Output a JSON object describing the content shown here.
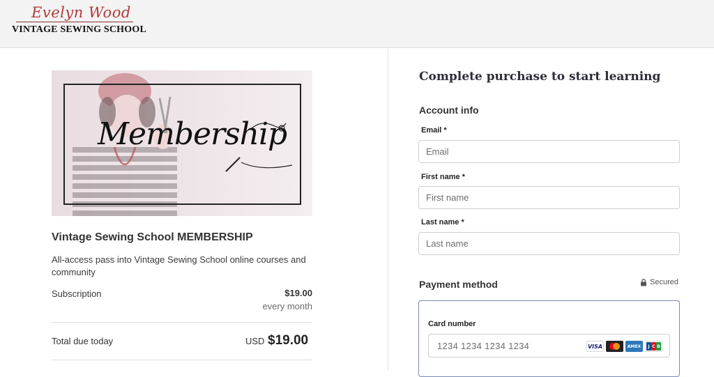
{
  "header": {
    "logo_script": "Evelyn Wood",
    "logo_sub": "VINTAGE SEWING SCHOOL"
  },
  "product": {
    "hero_title": "Membership",
    "title": "Vintage Sewing School MEMBERSHIP",
    "description": "All-access pass into Vintage Sewing School online courses and community",
    "subscription_label": "Subscription",
    "subscription_price": "$19.00",
    "subscription_period": "every month",
    "total_label": "Total due today",
    "total_currency": "USD",
    "total_amount": "$19.00"
  },
  "checkout": {
    "heading": "Complete purchase to start learning",
    "account_section": "Account info",
    "fields": {
      "email_label": "Email *",
      "email_placeholder": "Email",
      "first_name_label": "First name *",
      "first_name_placeholder": "First name",
      "last_name_label": "Last name *",
      "last_name_placeholder": "Last name"
    },
    "payment": {
      "title": "Payment method",
      "secured": "Secured",
      "card_number_label": "Card number",
      "card_number_placeholder": "1234 1234 1234 1234",
      "card_brands": [
        "VISA",
        "Mastercard",
        "AMEX",
        "JCB"
      ]
    }
  },
  "colors": {
    "logo_red": "#b23a3a",
    "heading": "#2e2e3a",
    "card_border_active": "#7a8bb0"
  }
}
